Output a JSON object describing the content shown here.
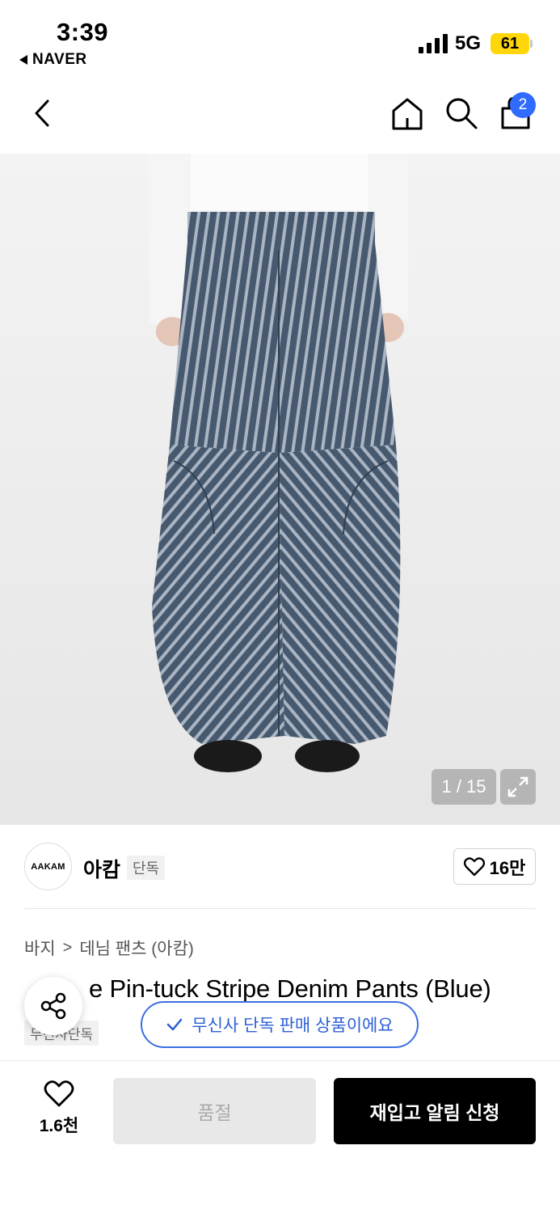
{
  "status_bar": {
    "time": "3:39",
    "back_app": "NAVER",
    "network": "5G",
    "battery": "61"
  },
  "header": {
    "cart_count": "2",
    "icons": [
      "back-icon",
      "home-icon",
      "search-icon",
      "shopping-bag-icon"
    ]
  },
  "gallery": {
    "pager": "1 / 15",
    "current": 1,
    "total": 15
  },
  "brand": {
    "logo_text": "AAKAM",
    "name": "아캄",
    "tag": "단독",
    "like_count": "16만"
  },
  "breadcrumb": {
    "items": [
      "바지",
      "데님 팬츠 (아캄)"
    ],
    "separator": ">"
  },
  "product": {
    "title_visible": "e Pin-tuck Stripe Denim Pants (Blue)",
    "exclusive_tag": "무신사단독"
  },
  "toast": {
    "message": "무신사 단독 판매 상품이에요"
  },
  "bottom_bar": {
    "wish_count": "1.6천",
    "soldout_label": "품절",
    "restock_label": "재입고 알림 신청"
  },
  "colors": {
    "accent_blue": "#2f6bff",
    "toast_blue": "#2c5fd6",
    "battery_yellow": "#ffd60a",
    "denim": "#4a5f7a"
  }
}
